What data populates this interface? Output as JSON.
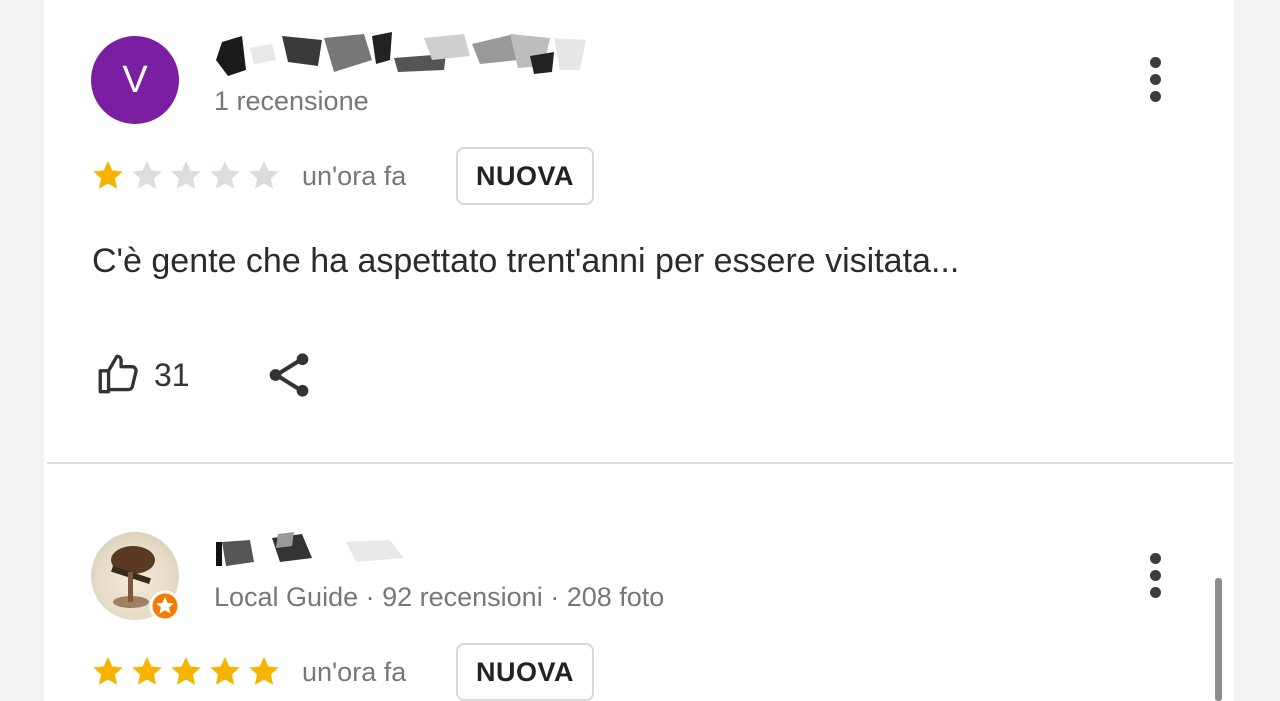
{
  "reviews": [
    {
      "avatar_letter": "V",
      "avatar_color": "#7b1fa2",
      "meta": "1 recensione",
      "rating": 1,
      "max_rating": 5,
      "time": "un'ora fa",
      "badge": "NUOVA",
      "text": "C'è gente che ha aspettato trent'anni per essere visitata...",
      "likes": "31"
    },
    {
      "meta": "Local Guide · 92 recensioni · 208 foto",
      "rating": 5,
      "max_rating": 5,
      "time": "un'ora fa",
      "badge": "NUOVA"
    }
  ],
  "colors": {
    "star_filled": "#f4b400",
    "star_empty": "#dadce0",
    "badge_local_guide": "#f57c00"
  },
  "icons": [
    "more-vert-icon",
    "thumbs-up-icon",
    "share-icon",
    "star-icon",
    "local-guide-badge-icon"
  ]
}
